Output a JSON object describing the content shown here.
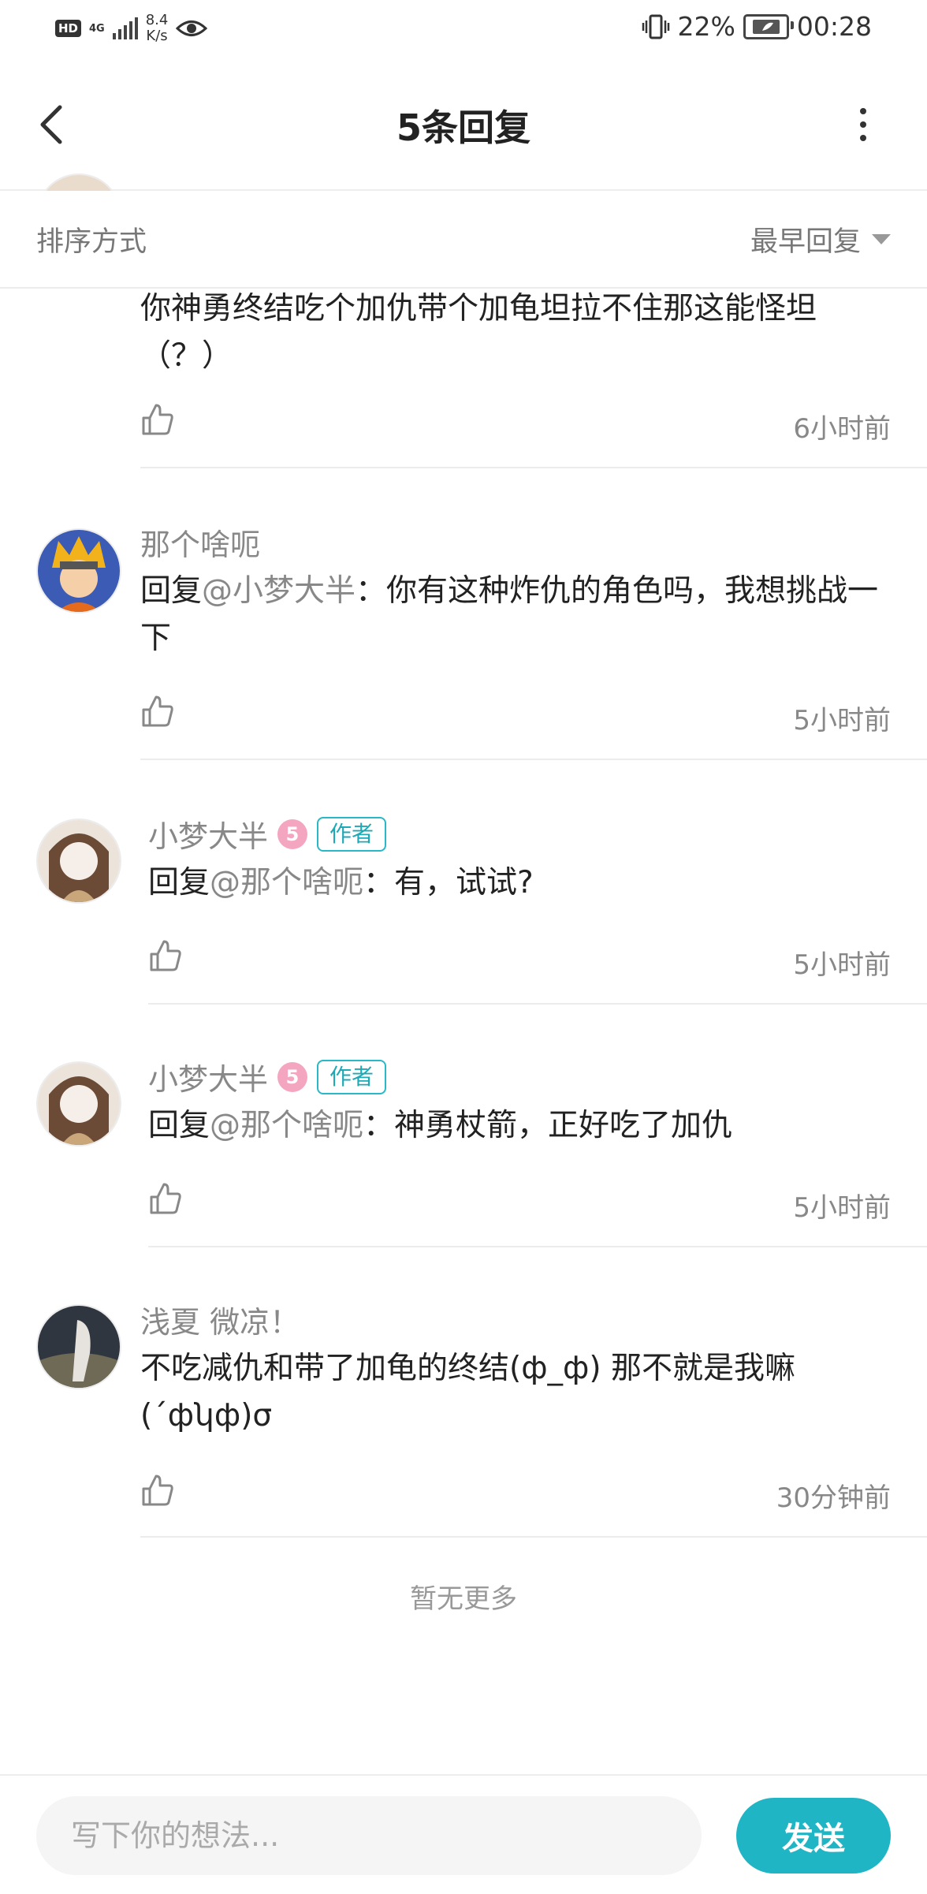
{
  "status_bar": {
    "hd": "HD",
    "network": "4G",
    "speed_value": "8.4",
    "speed_unit": "K/s",
    "battery_percent": "22%",
    "time": "00:28"
  },
  "header": {
    "title": "5条回复"
  },
  "sort": {
    "label": "排序方式",
    "value": "最早回复"
  },
  "comments": [
    {
      "text": "你神勇终结吃个加仇带个加龟坦拉不住那这能怪坦（？）",
      "time": "6小时前"
    },
    {
      "name": "那个啥呃",
      "reply_prefix": "回复",
      "reply_to": "@小梦大半",
      "text": "：你有这种炸仇的角色吗，我想挑战一下",
      "time": "5小时前"
    },
    {
      "name": "小梦大半",
      "level": "5",
      "author_badge": "作者",
      "reply_prefix": "回复",
      "reply_to": "@那个啥呃",
      "text": "：有，试试?",
      "time": "5小时前"
    },
    {
      "name": "小梦大半",
      "level": "5",
      "author_badge": "作者",
      "reply_prefix": "回复",
      "reply_to": "@那个啥呃",
      "text": "：神勇杖箭，正好吃了加仇",
      "time": "5小时前"
    },
    {
      "name": "浅夏 微凉！",
      "text": "不吃减仇和带了加龟的终结(ф_ф) 那不就是我嘛(´фʮф)σ",
      "time": "30分钟前"
    }
  ],
  "footer_note": "暂无更多",
  "composer": {
    "placeholder": "写下你的想法...",
    "send_label": "发送"
  },
  "colors": {
    "accent": "#1fb5c4",
    "level_badge": "#f4a6c1",
    "muted_text": "#888888"
  }
}
